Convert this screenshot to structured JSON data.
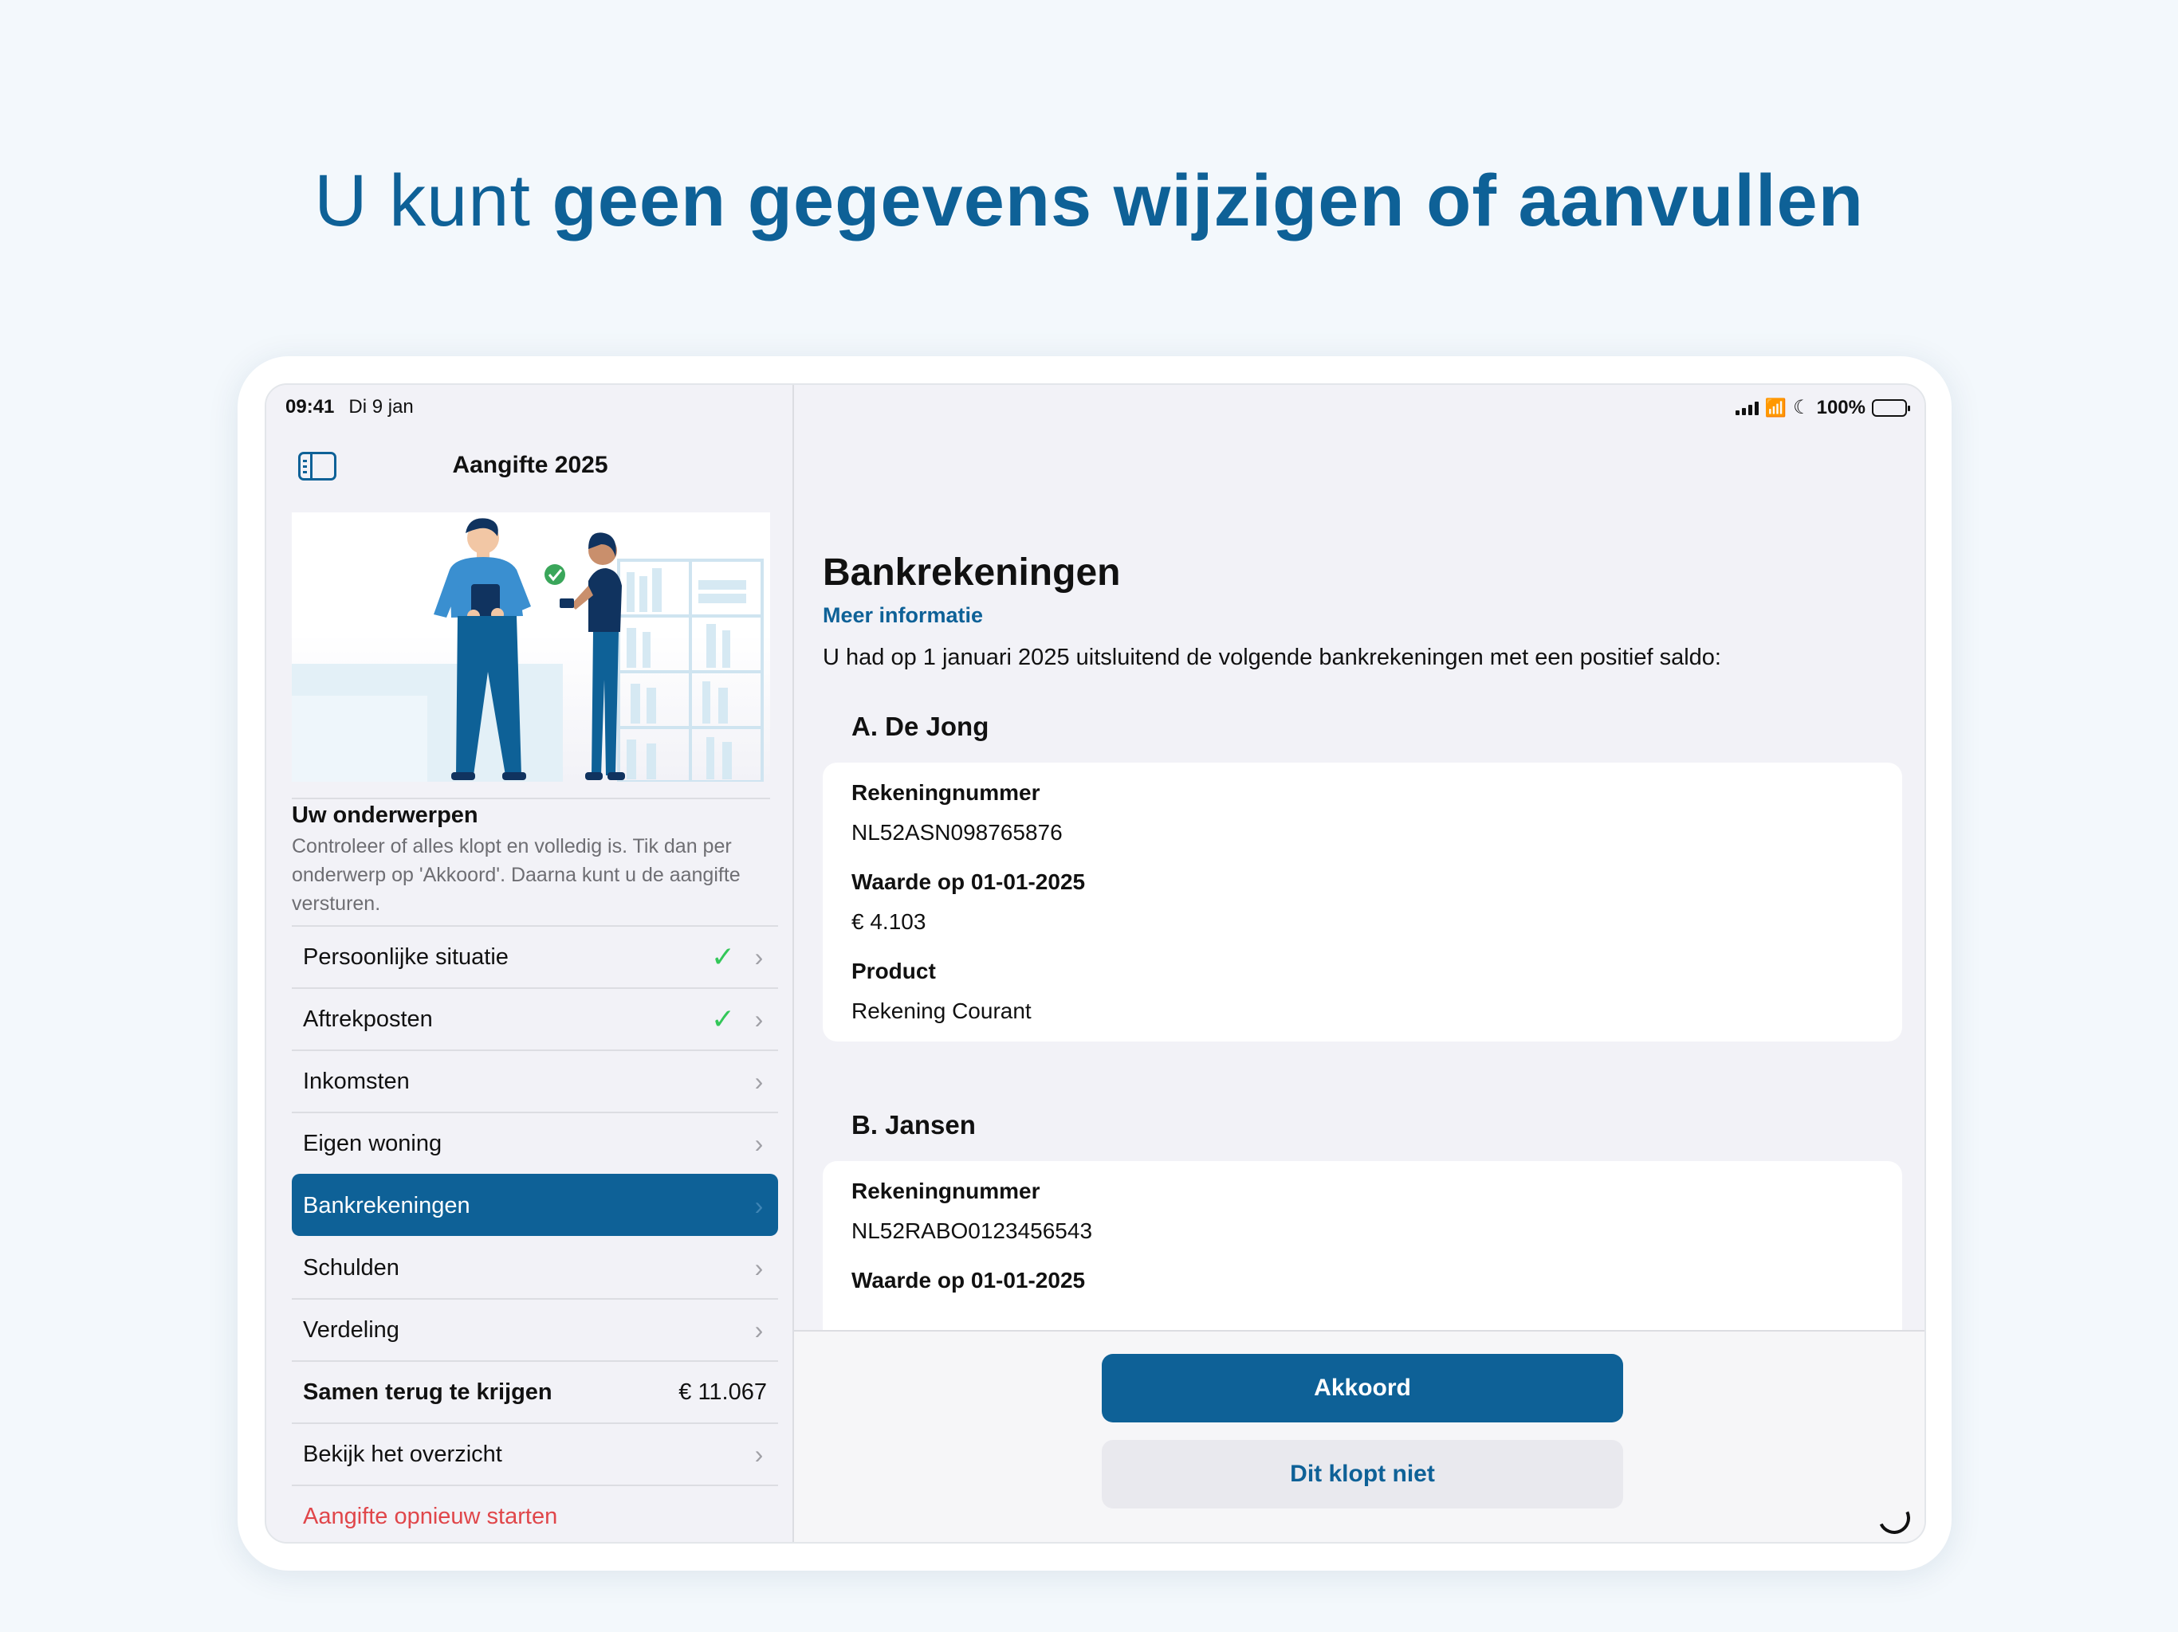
{
  "headline": {
    "light": "U kunt ",
    "bold": "geen gegevens wijzigen of aanvullen"
  },
  "status_bar": {
    "time": "09:41",
    "date": "Di 9 jan",
    "battery": "100%"
  },
  "sidebar": {
    "title": "Aangifte 2025",
    "topics_title": "Uw onderwerpen",
    "topics_desc": "Controleer of alles klopt en volledig is. Tik dan per onderwerp op 'Akkoord'. Daarna kunt u de aangifte versturen.",
    "items": [
      {
        "label": "Persoonlijke situatie",
        "checked": true
      },
      {
        "label": "Aftrekposten",
        "checked": true
      },
      {
        "label": "Inkomsten",
        "checked": false
      },
      {
        "label": "Eigen woning",
        "checked": false
      },
      {
        "label": "Bankrekeningen",
        "checked": false,
        "selected": true
      },
      {
        "label": "Schulden",
        "checked": false
      },
      {
        "label": "Verdeling",
        "checked": false
      }
    ],
    "total_label": "Samen terug te krijgen",
    "total_amount": "€ 11.067",
    "overview_label": "Bekijk het overzicht",
    "restart_label": "Aangifte opnieuw starten"
  },
  "main": {
    "title": "Bankrekeningen",
    "info_link": "Meer informatie",
    "intro": "U had op 1 januari 2025 uitsluitend de volgende bankrekeningen met een positief saldo:",
    "persons": [
      {
        "name": "A. De Jong",
        "fields": [
          {
            "label": "Rekeningnummer",
            "value": "NL52ASN098765876"
          },
          {
            "label": "Waarde op 01-01-2025",
            "value": "€ 4.103"
          },
          {
            "label": "Product",
            "value": "Rekening Courant"
          }
        ]
      },
      {
        "name": "B. Jansen",
        "fields": [
          {
            "label": "Rekeningnummer",
            "value": "NL52RABO0123456543"
          },
          {
            "label": "Waarde op 01-01-2025",
            "value": ""
          }
        ]
      }
    ],
    "btn_primary": "Akkoord",
    "btn_secondary": "Dit klopt niet"
  },
  "colors": {
    "brand": "#0e6197",
    "check": "#34c759",
    "danger": "#e0464a",
    "background": "#f3f8fc"
  }
}
